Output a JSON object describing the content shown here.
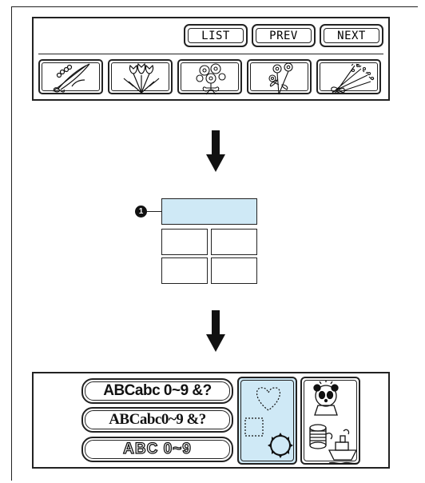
{
  "nav_buttons": {
    "list": "LIST",
    "prev": "PREV",
    "next": "NEXT"
  },
  "callout": {
    "number": "1"
  },
  "font_buttons": [
    {
      "label": "ABCabc 0~9 &?"
    },
    {
      "label": "ABCabc0~9 &?"
    },
    {
      "label": "ABC  0~9"
    }
  ],
  "colors": {
    "highlight": "#cfe9f6",
    "outline": "#222222"
  }
}
